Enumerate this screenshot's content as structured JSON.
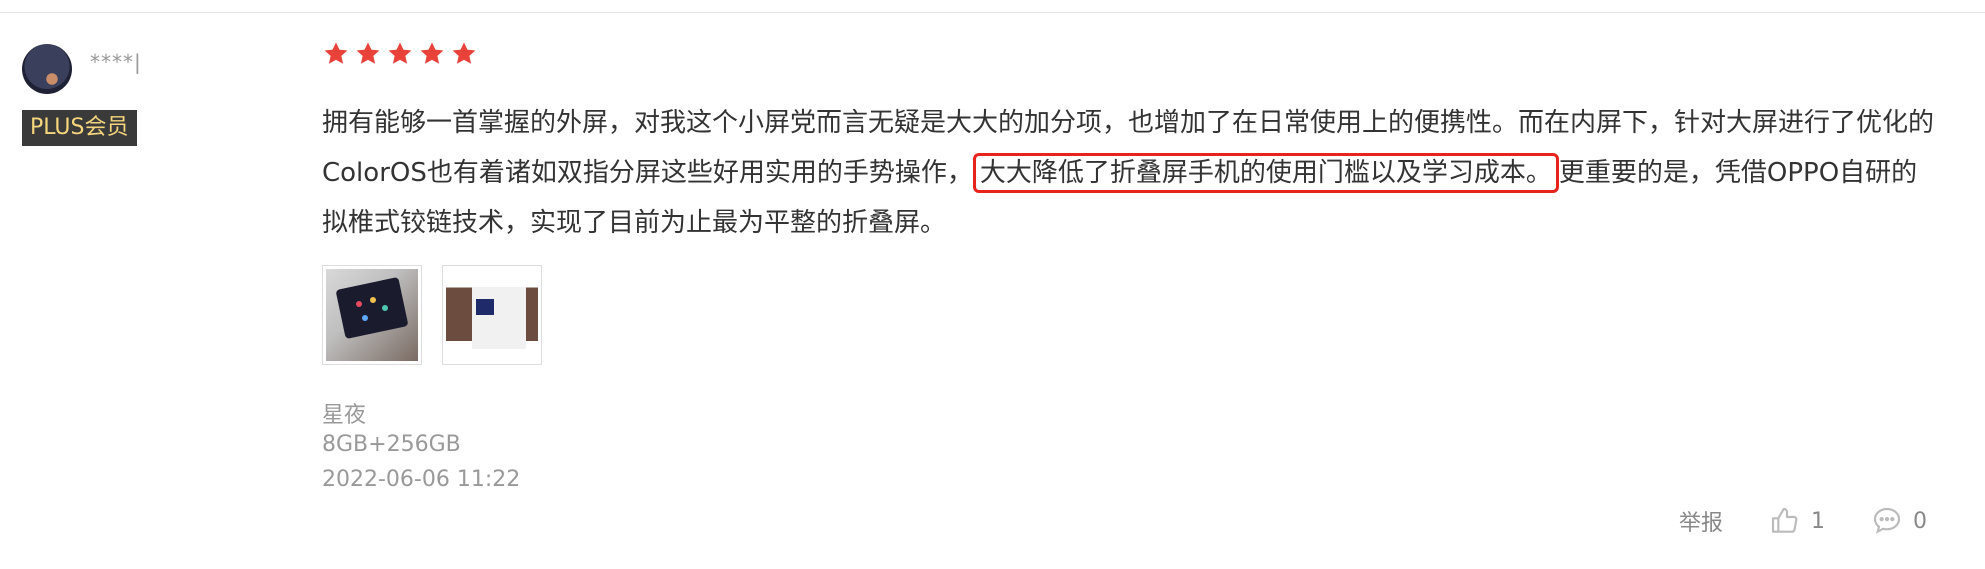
{
  "user": {
    "name": "****|",
    "badge": "PLUS会员"
  },
  "rating": {
    "stars": 5,
    "color": "#e8423a"
  },
  "review": {
    "text_before": "拥有能够一首掌握的外屏，对我这个小屏党而言无疑是大大的加分项，也增加了在日常使用上的便携性。而在内屏下，针对大屏进行了优化的ColorOS也有着诸如双指分屏这些好用实用的手势操作，",
    "text_highlight": "大大降低了折叠屏手机的使用门槛以及学习成本。",
    "text_after": "更重要的是，凭借OPPO自研的拟椎式铰链技术，实现了目前为止最为平整的折叠屏。"
  },
  "images": [
    {
      "icon": "photo-foldable-phone"
    },
    {
      "icon": "photo-phone-box"
    }
  ],
  "meta": {
    "color": "星夜",
    "spec": "8GB+256GB",
    "datetime": "2022-06-06 11:22"
  },
  "actions": {
    "report_label": "举报",
    "likes": "1",
    "comments": "0"
  }
}
